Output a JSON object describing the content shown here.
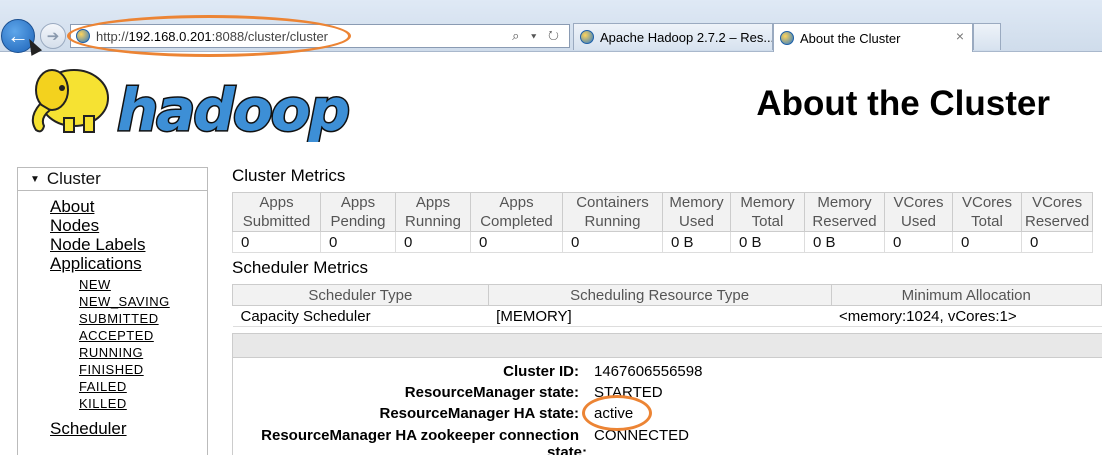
{
  "browser": {
    "url_prefix": "http://",
    "url_host": "192.168.0.201",
    "url_rest": ":8088/cluster/cluster",
    "address_tools": "⌕ ▾ ↻",
    "tabs": [
      {
        "label": "Apache Hadoop 2.7.2 – Res..."
      },
      {
        "label": "About the Cluster",
        "close": "×"
      }
    ]
  },
  "logo_text": "hadoop",
  "page_title": "About the Cluster",
  "sidebar": {
    "header": "Cluster",
    "links": [
      "About",
      "Nodes",
      "Node Labels",
      "Applications"
    ],
    "app_states": [
      "NEW",
      "NEW_SAVING",
      "SUBMITTED",
      "ACCEPTED",
      "RUNNING",
      "FINISHED",
      "FAILED",
      "KILLED"
    ],
    "scheduler": "Scheduler"
  },
  "cluster_metrics": {
    "title": "Cluster Metrics",
    "headers": [
      [
        "Apps",
        "Submitted"
      ],
      [
        "Apps",
        "Pending"
      ],
      [
        "Apps",
        "Running"
      ],
      [
        "Apps",
        "Completed"
      ],
      [
        "Containers",
        "Running"
      ],
      [
        "Memory",
        "Used"
      ],
      [
        "Memory",
        "Total"
      ],
      [
        "Memory",
        "Reserved"
      ],
      [
        "VCores",
        "Used"
      ],
      [
        "VCores",
        "Total"
      ],
      [
        "VCores",
        "Reserved"
      ]
    ],
    "values": [
      "0",
      "0",
      "0",
      "0",
      "0",
      "0 B",
      "0 B",
      "0 B",
      "0",
      "0",
      "0"
    ]
  },
  "scheduler_metrics": {
    "title": "Scheduler Metrics",
    "headers": [
      "Scheduler Type",
      "Scheduling Resource Type",
      "Minimum Allocation"
    ],
    "row": [
      "Capacity Scheduler",
      "[MEMORY]",
      "<memory:1024, vCores:1>"
    ]
  },
  "cluster_info": [
    {
      "label": "Cluster ID:",
      "value": "1467606556598"
    },
    {
      "label": "ResourceManager state:",
      "value": "STARTED"
    },
    {
      "label": "ResourceManager HA state:",
      "value": "active"
    },
    {
      "label": "ResourceManager HA zookeeper connection",
      "value": "CONNECTED"
    },
    {
      "label": "state:",
      "value": ""
    }
  ],
  "colors": {
    "highlight": "#ec8434",
    "logo_blue": "#3d8fd6",
    "logo_yellow": "#f6e232"
  }
}
